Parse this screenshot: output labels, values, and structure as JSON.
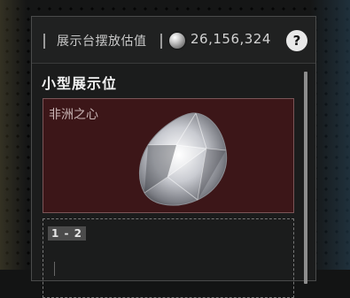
{
  "header": {
    "title": "展示台摆放估值",
    "currency_icon": "silver-coin-icon",
    "value": "26,156,324",
    "help_label": "?"
  },
  "section": {
    "title": "小型展示位"
  },
  "slots": [
    {
      "name": "非洲之心",
      "item_icon": "pear-cut-diamond",
      "background_color": "#3c1618"
    },
    {
      "badge": "1 - 2"
    }
  ],
  "colors": {
    "panel": "#1c1d1d",
    "slot_highlight": "#3c1618",
    "text": "#f0f0f0"
  }
}
